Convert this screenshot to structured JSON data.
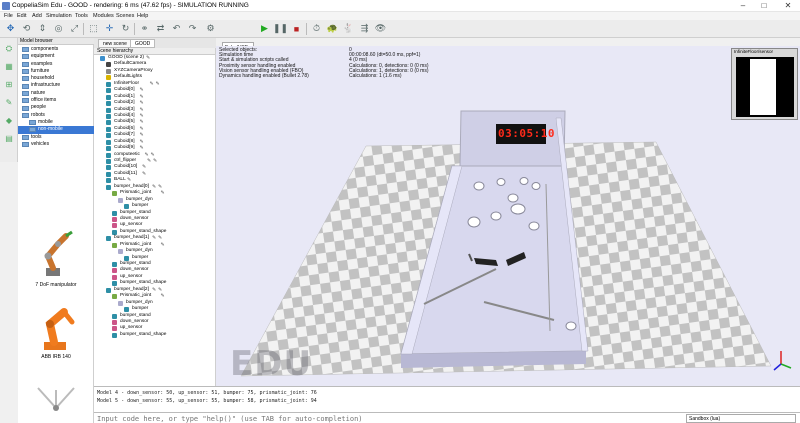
{
  "window": {
    "title": "CoppeliaSim Edu - GOOD - rendering: 6 ms (47.62 fps) - SIMULATION RUNNING",
    "minimize": "–",
    "maximize": "□",
    "close": "✕"
  },
  "menu": [
    "File",
    "Edit",
    "Add",
    "Simulation",
    "Tools",
    "Modules",
    "Scenes",
    "Help"
  ],
  "toolbar": {
    "camera_select": "Euler/VSE"
  },
  "model_browser": {
    "header": "Model browser",
    "items": [
      "components",
      "equipment",
      "examples",
      "furniture",
      "household",
      "infrastructure",
      "nature",
      "office items",
      "people",
      "robots",
      "mobile",
      "non-mobile",
      "tools",
      "vehicles"
    ],
    "selected": "non-mobile",
    "thumbnails": [
      "7 DoF manipulator",
      "ABB IRB 140",
      ""
    ]
  },
  "scene_tabs": [
    "new scene",
    "GOOD"
  ],
  "hierarchy": {
    "header": "Scene hierarchy",
    "items": [
      {
        "label": "GOOD (scene 2)",
        "depth": 0,
        "icon": "scene",
        "scripts": 1
      },
      {
        "label": "DefaultCamera",
        "depth": 1,
        "icon": "camera",
        "scripts": 0
      },
      {
        "label": "XYZCameraProxy",
        "depth": 1,
        "icon": "proxy",
        "scripts": 0
      },
      {
        "label": "DefaultLights",
        "depth": 1,
        "icon": "light",
        "scripts": 0
      },
      {
        "label": "InfiniteFloor",
        "depth": 1,
        "icon": "shape",
        "scripts": 2
      },
      {
        "label": "Cuboid[0]",
        "depth": 1,
        "icon": "shape",
        "scripts": 1
      },
      {
        "label": "Cuboid[1]",
        "depth": 1,
        "icon": "shape",
        "scripts": 1
      },
      {
        "label": "Cuboid[2]",
        "depth": 1,
        "icon": "shape",
        "scripts": 1
      },
      {
        "label": "Cuboid[3]",
        "depth": 1,
        "icon": "shape",
        "scripts": 1
      },
      {
        "label": "Cuboid[4]",
        "depth": 1,
        "icon": "shape",
        "scripts": 1
      },
      {
        "label": "Cuboid[5]",
        "depth": 1,
        "icon": "shape",
        "scripts": 1
      },
      {
        "label": "Cuboid[6]",
        "depth": 1,
        "icon": "shape",
        "scripts": 1
      },
      {
        "label": "Cuboid[7]",
        "depth": 1,
        "icon": "shape",
        "scripts": 1
      },
      {
        "label": "Cuboid[8]",
        "depth": 1,
        "icon": "shape",
        "scripts": 1
      },
      {
        "label": "Cuboid[9]",
        "depth": 1,
        "icon": "shape",
        "scripts": 1
      },
      {
        "label": "computeetic",
        "depth": 1,
        "icon": "shape",
        "scripts": 2
      },
      {
        "label": "ctrl_flipper",
        "depth": 1,
        "icon": "shape",
        "scripts": 2
      },
      {
        "label": "Cuboid[10]",
        "depth": 1,
        "icon": "shape",
        "scripts": 1
      },
      {
        "label": "Cuboid[11]",
        "depth": 1,
        "icon": "shape",
        "scripts": 1
      },
      {
        "label": "BALL",
        "depth": 1,
        "icon": "shape",
        "scripts": 1
      },
      {
        "label": "bumper_head[0]",
        "depth": 1,
        "icon": "shape",
        "scripts": 2
      },
      {
        "label": "Prismatic_joint",
        "depth": 2,
        "icon": "joint",
        "scripts": 1
      },
      {
        "label": "bumper_dyn",
        "depth": 3,
        "icon": "dyn",
        "scripts": 0
      },
      {
        "label": "bumper",
        "depth": 4,
        "icon": "shape",
        "scripts": 0
      },
      {
        "label": "bumper_stand",
        "depth": 2,
        "icon": "shape",
        "scripts": 0
      },
      {
        "label": "down_sensor",
        "depth": 2,
        "icon": "sensor",
        "scripts": 0
      },
      {
        "label": "up_sensor",
        "depth": 2,
        "icon": "sensor",
        "scripts": 0
      },
      {
        "label": "bumper_stand_shape",
        "depth": 2,
        "icon": "shape",
        "scripts": 0
      },
      {
        "label": "bumper_head[1]",
        "depth": 1,
        "icon": "shape",
        "scripts": 2
      },
      {
        "label": "Prismatic_joint",
        "depth": 2,
        "icon": "joint",
        "scripts": 1
      },
      {
        "label": "bumper_dyn",
        "depth": 3,
        "icon": "dyn",
        "scripts": 0
      },
      {
        "label": "bumper",
        "depth": 4,
        "icon": "shape",
        "scripts": 0
      },
      {
        "label": "bumper_stand",
        "depth": 2,
        "icon": "shape",
        "scripts": 0
      },
      {
        "label": "down_sensor",
        "depth": 2,
        "icon": "sensor",
        "scripts": 0
      },
      {
        "label": "up_sensor",
        "depth": 2,
        "icon": "sensor",
        "scripts": 0
      },
      {
        "label": "bumper_stand_shape",
        "depth": 2,
        "icon": "shape",
        "scripts": 0
      },
      {
        "label": "bumper_head[2]",
        "depth": 1,
        "icon": "shape",
        "scripts": 2
      },
      {
        "label": "Prismatic_joint",
        "depth": 2,
        "icon": "joint",
        "scripts": 1
      },
      {
        "label": "bumper_dyn",
        "depth": 3,
        "icon": "dyn",
        "scripts": 0
      },
      {
        "label": "bumper",
        "depth": 4,
        "icon": "shape",
        "scripts": 0
      },
      {
        "label": "bumper_stand",
        "depth": 2,
        "icon": "shape",
        "scripts": 0
      },
      {
        "label": "down_sensor",
        "depth": 2,
        "icon": "sensor",
        "scripts": 0
      },
      {
        "label": "up_sensor",
        "depth": 2,
        "icon": "sensor",
        "scripts": 0
      },
      {
        "label": "bumper_stand_shape",
        "depth": 2,
        "icon": "shape",
        "scripts": 0
      }
    ]
  },
  "info": [
    {
      "k": "Selected objects:",
      "v": "0"
    },
    {
      "k": "Simulation time",
      "v": "00:00:08.60 (dt=50.0 ms, ppf=1)"
    },
    {
      "k": "Start & simulation scripts called",
      "v": "4 (0 ms)"
    },
    {
      "k": "Proximity sensor handling enabled",
      "v": "Calculations: 0, detections: 0 (0 ms)"
    },
    {
      "k": "Vision sensor handling enabled (FBO)",
      "v": "Calculations: 1, detections: 0 (0 ms)"
    },
    {
      "k": "Dynamics handling enabled (Bullet 2.78)",
      "v": "Calculations: 1 (1.6 ms)"
    }
  ],
  "sensor_panel": {
    "label": "InfiniteFloor/sensor"
  },
  "scoreboard": "03:05:10",
  "watermark": "EDU",
  "console": [
    "Model 4 - down_sensor: 50, up_sensor: 51, bumper: 75, prismatic_joint: 76",
    "Model 5 - down_sensor: 55, up_sensor: 55, bumper: 58, prismatic_joint: 94"
  ],
  "command": {
    "placeholder": "Input code here, or type \"help()\" (use TAB for auto-completion)",
    "language": "Sandbox (lua)"
  },
  "colors": {
    "accent": "#3a78d4",
    "table": "#d8d8ee",
    "floor_light": "#f2f2f2",
    "floor_dark": "#c2c2c2",
    "scoreboard_red": "#ff2a1a"
  }
}
